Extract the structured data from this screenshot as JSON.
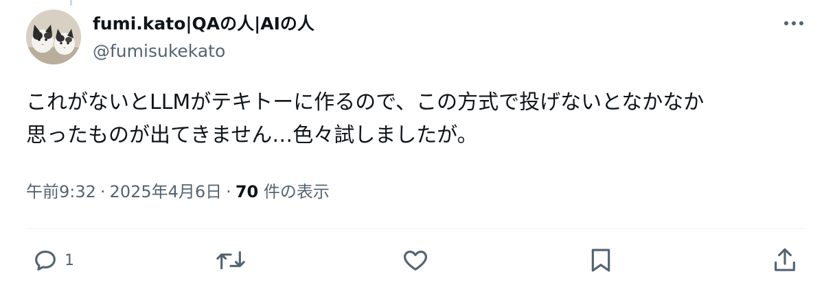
{
  "author": {
    "display_name": "fumi.kato|QAの人|AIの人",
    "handle": "@fumisukekato"
  },
  "tweet": {
    "line1": "これがないとLLMがテキトーに作るので、この方式で投げないとなかなか",
    "line2": "思ったものが出てきません…色々試しましたが。"
  },
  "meta": {
    "time": "午前9:32",
    "date": "2025年4月6日",
    "separator": "·",
    "views_count": "70",
    "views_label": "件の表示"
  },
  "actions": {
    "reply_count": "1"
  },
  "icons": {
    "more": "more-icon",
    "reply": "reply-icon",
    "retweet": "retweet-icon",
    "like": "like-icon",
    "bookmark": "bookmark-icon",
    "share": "share-icon"
  },
  "colors": {
    "text": "#0f1419",
    "secondary": "#536471",
    "divider": "#eff3f4"
  }
}
